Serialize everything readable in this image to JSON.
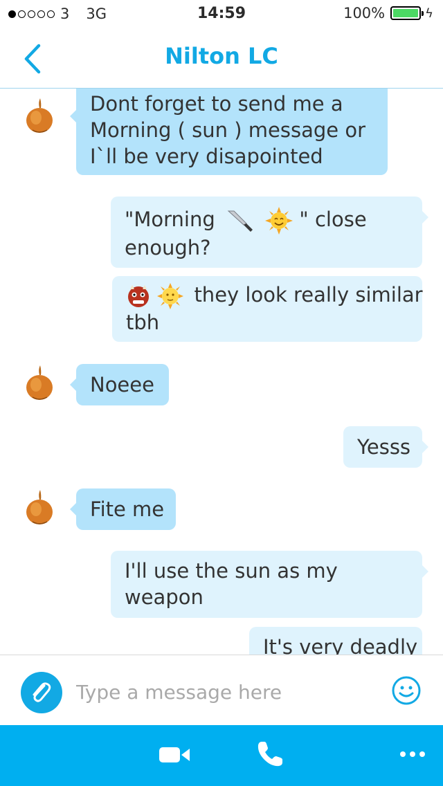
{
  "status_bar": {
    "carrier": "3",
    "network": "3G",
    "time": "14:59",
    "battery": "100%",
    "signal_dots_filled": 1,
    "signal_dots_total": 5
  },
  "header": {
    "title": "Nilton LC"
  },
  "messages": [
    {
      "from": "contact",
      "lines": [
        "Dont forget to send me a",
        "Morning ( sun ) message or",
        "I`ll be very disapointed"
      ]
    },
    {
      "from": "me",
      "lines": [
        "\"Morning",
        "\" close",
        "enough?"
      ]
    },
    {
      "from": "me",
      "lines": [
        "they look really similar",
        "tbh"
      ]
    },
    {
      "from": "contact",
      "lines": [
        "Noeee"
      ]
    },
    {
      "from": "me",
      "lines": [
        "Yesss"
      ]
    },
    {
      "from": "contact",
      "lines": [
        "Fite me"
      ]
    },
    {
      "from": "me",
      "lines": [
        "I'll use the sun as my",
        "weapon"
      ]
    },
    {
      "from": "me",
      "lines": [
        "It's very deadly"
      ]
    }
  ],
  "composer": {
    "placeholder": "Type a message here"
  },
  "colors": {
    "accent": "#12a9e4",
    "bottom_bar": "#00aff0",
    "incoming_bubble": "#b3e3fb",
    "outgoing_bubble": "#dff3fd"
  },
  "icons": {
    "back": "chevron-left-icon",
    "attach": "paperclip-icon",
    "emoji": "smiley-icon",
    "video": "video-camera-icon",
    "call": "phone-icon",
    "more": "more-dots-icon"
  }
}
